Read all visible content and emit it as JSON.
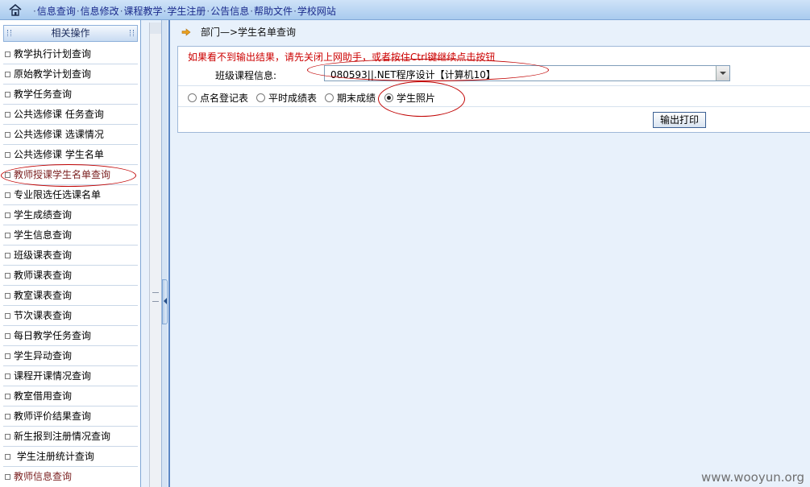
{
  "topnav": {
    "items": [
      "信息查询",
      "信息修改",
      "课程教学",
      "学生注册",
      "公告信息",
      "帮助文件",
      "学校网站"
    ]
  },
  "sidebar": {
    "header": "相关操作",
    "items": [
      {
        "label": "教学执行计划查询"
      },
      {
        "label": "原始教学计划查询"
      },
      {
        "label": "教学任务查询"
      },
      {
        "label": "公共选修课 任务查询"
      },
      {
        "label": "公共选修课 选课情况"
      },
      {
        "label": "公共选修课 学生名单"
      },
      {
        "label": "教师授课学生名单查询"
      },
      {
        "label": "专业限选任选课名单"
      },
      {
        "label": "学生成绩查询"
      },
      {
        "label": "学生信息查询"
      },
      {
        "label": "班级课表查询"
      },
      {
        "label": "教师课表查询"
      },
      {
        "label": "教室课表查询"
      },
      {
        "label": "节次课表查询"
      },
      {
        "label": "每日教学任务查询"
      },
      {
        "label": "学生异动查询"
      },
      {
        "label": "课程开课情况查询"
      },
      {
        "label": "教室借用查询"
      },
      {
        "label": "教师评价结果查询"
      },
      {
        "label": "新生报到注册情况查询"
      },
      {
        "label": " 学生注册统计查询"
      },
      {
        "label": "教师信息查询"
      }
    ]
  },
  "main": {
    "breadcrumb": "部门—>学生名单查询",
    "hint": "如果看不到输出结果，请先关闭上网助手，或者按住Ctrl键继续点击按钮",
    "class_label": "班级课程信息:",
    "class_value": "080593||.NET程序设计【计算机10】",
    "radios": [
      {
        "label": "点名登记表",
        "checked": false
      },
      {
        "label": "平时成绩表",
        "checked": false
      },
      {
        "label": "期末成绩",
        "checked": false
      },
      {
        "label": "学生照片",
        "checked": true
      }
    ],
    "print_button": "输出打印"
  },
  "watermark": "www.wooyun.org",
  "colors": {
    "annotation": "#c00000",
    "hint": "#cc0000",
    "accent": "#5b86c4"
  }
}
